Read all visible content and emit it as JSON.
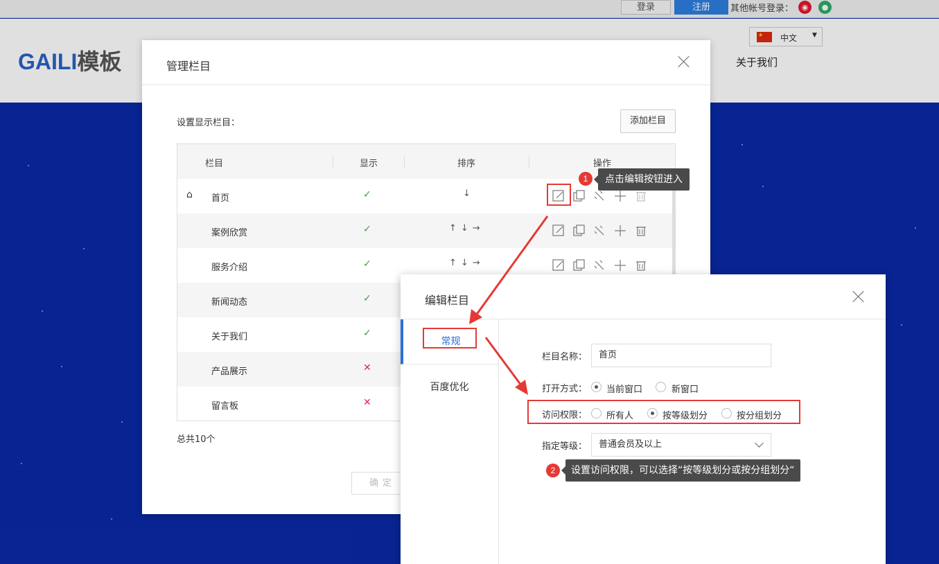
{
  "topbar": {
    "login": "登录",
    "register": "注册",
    "other_login": "其他帐号登录："
  },
  "site": {
    "logo_a": "GAILI",
    "logo_b": "模板",
    "lang": "中文",
    "flag": "★",
    "nav_about": "关于我们"
  },
  "manage": {
    "title": "管理栏目",
    "set_label": "设置显示栏目：",
    "add_button": "添加栏目",
    "columns": {
      "name": "栏目",
      "show": "显示",
      "sort": "排序",
      "ops": "操作"
    },
    "rows": [
      {
        "name": "首页",
        "show": "✓",
        "sort": "↓"
      },
      {
        "name": "案例欣赏",
        "show": "✓",
        "sort": "↑↓→"
      },
      {
        "name": "服务介绍",
        "show": "✓",
        "sort": "↑↓→"
      },
      {
        "name": "新闻动态",
        "show": "✓",
        "sort": ""
      },
      {
        "name": "关于我们",
        "show": "✓",
        "sort": ""
      },
      {
        "name": "产品展示",
        "show": "✕",
        "sort": ""
      },
      {
        "name": "留言板",
        "show": "✕",
        "sort": ""
      }
    ],
    "total": "总共10个",
    "confirm": "确定"
  },
  "edit": {
    "title": "编辑栏目",
    "tabs": [
      "常规",
      "百度优化"
    ],
    "name_label": "栏目名称：",
    "name_value": "首页",
    "open_label": "打开方式：",
    "open_options": [
      "当前窗口",
      "新窗口"
    ],
    "access_label": "访问权限：",
    "access_options": [
      "所有人",
      "按等级划分",
      "按分组划分"
    ],
    "level_label": "指定等级：",
    "level_value": "普通会员及以上"
  },
  "annotations": {
    "step1_num": "1",
    "step1_text": "点击编辑按钮进入",
    "step2_num": "2",
    "step2_text": "设置访问权限，可以选择“按等级划分或按分组划分“"
  },
  "colors": {
    "accent": "#2d6fd6",
    "annotation": "#e53935",
    "check": "#3aa335",
    "cross": "#e0245e"
  }
}
